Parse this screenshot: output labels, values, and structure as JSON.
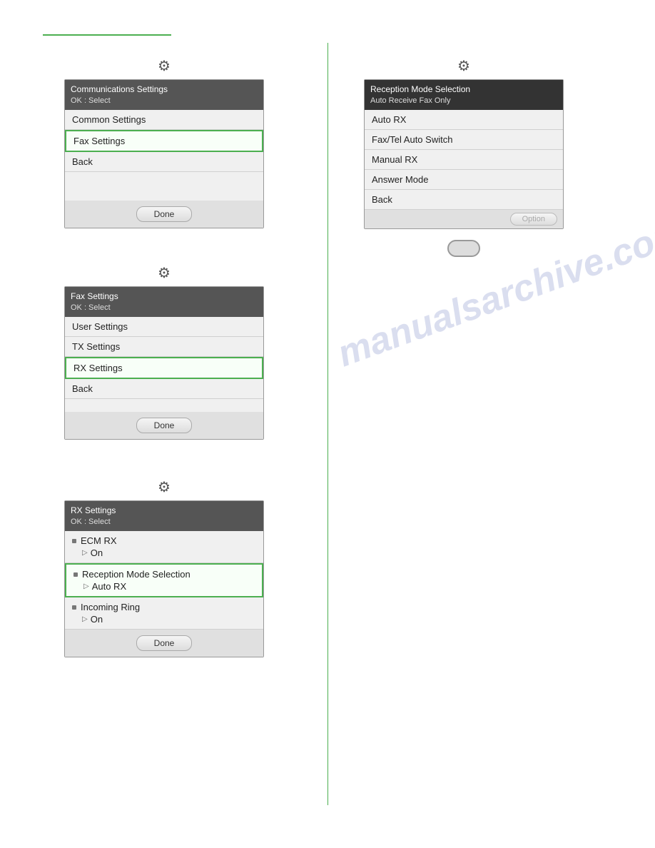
{
  "topLine": {},
  "watermark": "manualsarchive.com",
  "leftColumn": {
    "block1": {
      "gearIcon": "⚙",
      "header": {
        "title": "Communications Settings",
        "subtitle": "OK : Select"
      },
      "rows": [
        {
          "label": "Common Settings",
          "selected": false
        },
        {
          "label": "Fax Settings",
          "selected": true
        },
        {
          "label": "Back",
          "selected": false
        }
      ],
      "footer": {
        "doneLabel": "Done"
      }
    },
    "block2": {
      "gearIcon": "⚙",
      "header": {
        "title": "Fax Settings",
        "subtitle": "OK : Select"
      },
      "rows": [
        {
          "label": "User Settings",
          "selected": false
        },
        {
          "label": "TX Settings",
          "selected": false
        },
        {
          "label": "RX Settings",
          "selected": true
        },
        {
          "label": "Back",
          "selected": false
        }
      ],
      "footer": {
        "doneLabel": "Done"
      }
    },
    "block3": {
      "gearIcon": "⚙",
      "header": {
        "title": "RX Settings",
        "subtitle": "OK : Select"
      },
      "subRows": [
        {
          "label": "ECM RX",
          "value": "On",
          "selected": false
        },
        {
          "label": "Reception Mode Selection",
          "value": "Auto RX",
          "selected": true
        },
        {
          "label": "Incoming Ring",
          "value": "On",
          "selected": false
        }
      ],
      "footer": {
        "doneLabel": "Done"
      }
    }
  },
  "rightColumn": {
    "block1": {
      "gearIcon": "⚙",
      "header": {
        "title": "Reception Mode Selection",
        "subtitle": "Auto Receive Fax Only"
      },
      "rows": [
        {
          "label": "Auto RX",
          "selected": false
        },
        {
          "label": "Fax/Tel Auto Switch",
          "selected": false
        },
        {
          "label": "Manual RX",
          "selected": false
        },
        {
          "label": "Answer Mode",
          "selected": false
        },
        {
          "label": "Back",
          "selected": false
        }
      ],
      "optionLabel": "Option",
      "ovalIcon": ""
    }
  }
}
